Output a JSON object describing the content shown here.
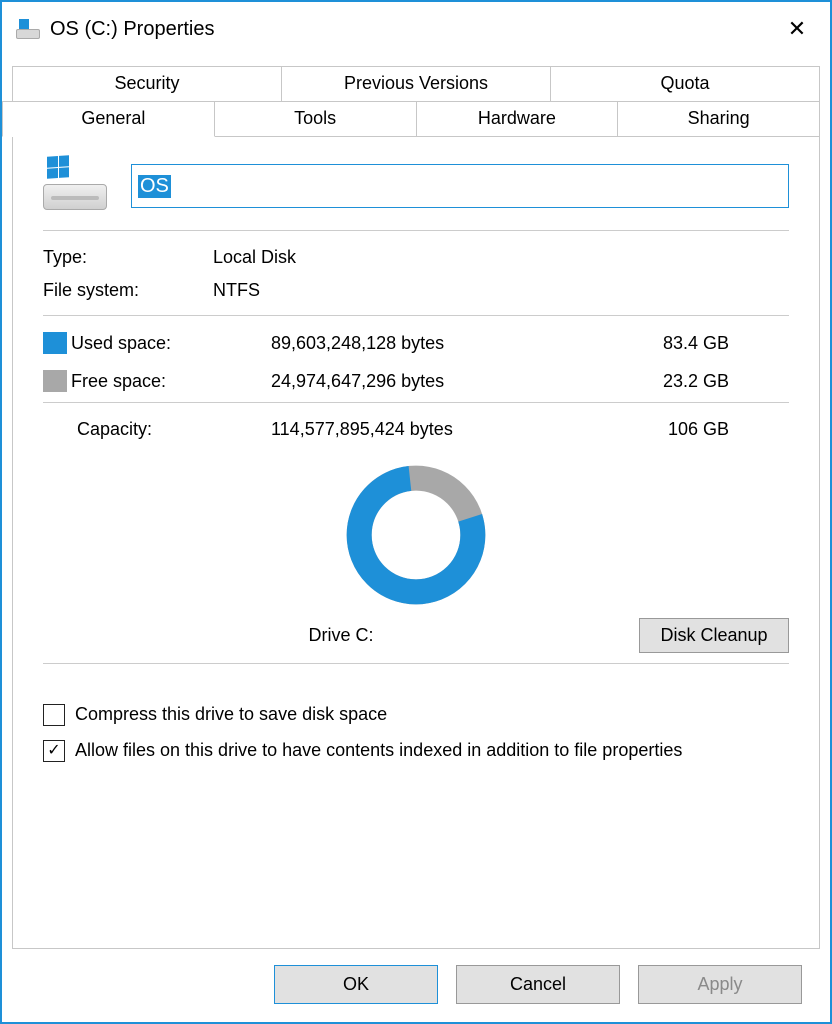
{
  "window": {
    "title": "OS (C:) Properties"
  },
  "tabs": {
    "row1": [
      "Security",
      "Previous Versions",
      "Quota"
    ],
    "row2": [
      "General",
      "Tools",
      "Hardware",
      "Sharing"
    ],
    "active": "General"
  },
  "general": {
    "name_value": "OS",
    "type_label": "Type:",
    "type_value": "Local Disk",
    "fs_label": "File system:",
    "fs_value": "NTFS",
    "used_label": "Used space:",
    "used_bytes": "89,603,248,128 bytes",
    "used_gb": "83.4 GB",
    "free_label": "Free space:",
    "free_bytes": "24,974,647,296 bytes",
    "free_gb": "23.2 GB",
    "capacity_label": "Capacity:",
    "capacity_bytes": "114,577,895,424 bytes",
    "capacity_gb": "106 GB",
    "drive_label": "Drive C:",
    "cleanup_label": "Disk Cleanup",
    "compress_label": "Compress this drive to save disk space",
    "index_label": "Allow files on this drive to have contents indexed in addition to file properties",
    "compress_checked": false,
    "index_checked": true
  },
  "buttons": {
    "ok": "OK",
    "cancel": "Cancel",
    "apply": "Apply"
  },
  "colors": {
    "used": "#1E90D8",
    "free": "#A8A8A8"
  },
  "chart_data": {
    "type": "pie",
    "title": "Drive C:",
    "series": [
      {
        "name": "Used space",
        "value": 89603248128,
        "display": "83.4 GB",
        "color": "#1E90D8"
      },
      {
        "name": "Free space",
        "value": 24974647296,
        "display": "23.2 GB",
        "color": "#A8A8A8"
      }
    ],
    "total": {
      "label": "Capacity",
      "value": 114577895424,
      "display": "106 GB"
    }
  }
}
